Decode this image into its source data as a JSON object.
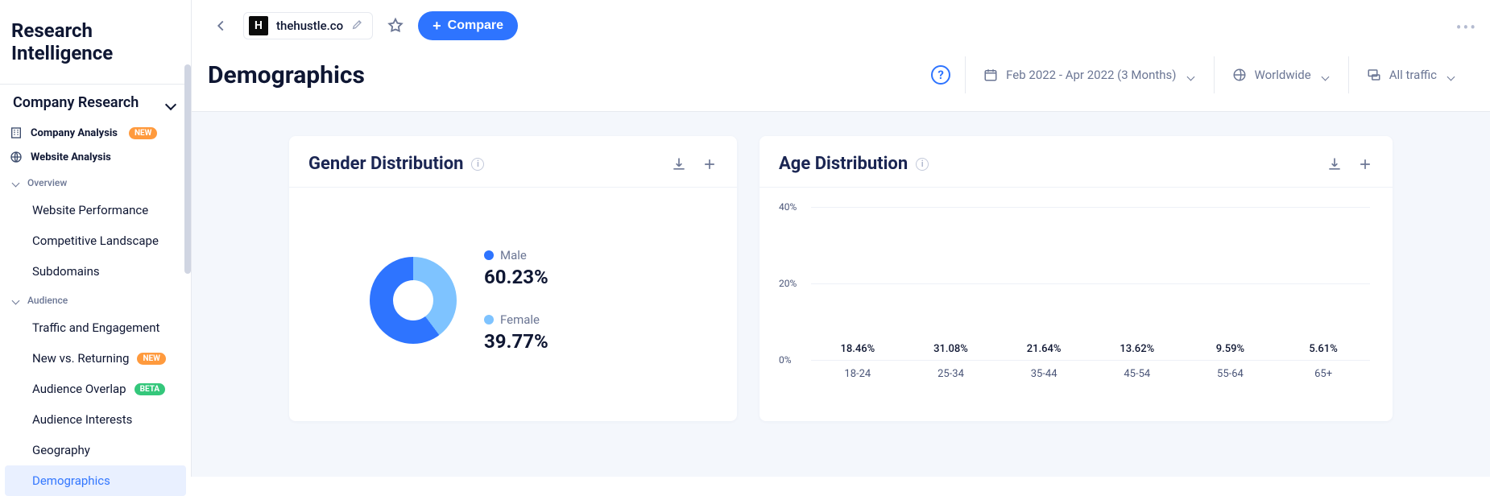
{
  "brand": "Research Intelligence",
  "sidebar": {
    "section": "Company Research",
    "items_top": [
      {
        "label": "Company Analysis",
        "badge": "NEW",
        "badge_kind": "new"
      },
      {
        "label": "Website Analysis",
        "badge": "",
        "badge_kind": ""
      }
    ],
    "groups": [
      {
        "label": "Overview",
        "items": [
          {
            "label": "Website Performance",
            "badge": "",
            "badge_kind": ""
          },
          {
            "label": "Competitive Landscape",
            "badge": "",
            "badge_kind": ""
          },
          {
            "label": "Subdomains",
            "badge": "",
            "badge_kind": ""
          }
        ]
      },
      {
        "label": "Audience",
        "items": [
          {
            "label": "Traffic and Engagement",
            "badge": "",
            "badge_kind": ""
          },
          {
            "label": "New vs. Returning",
            "badge": "NEW",
            "badge_kind": "new"
          },
          {
            "label": "Audience Overlap",
            "badge": "BETA",
            "badge_kind": "beta"
          },
          {
            "label": "Audience Interests",
            "badge": "",
            "badge_kind": ""
          },
          {
            "label": "Geography",
            "badge": "",
            "badge_kind": ""
          },
          {
            "label": "Demographics",
            "badge": "",
            "badge_kind": "",
            "active": true
          }
        ]
      }
    ]
  },
  "topbar": {
    "site": "thehustle.co",
    "site_initial": "H",
    "compare_label": "Compare",
    "help": "?"
  },
  "page_title": "Demographics",
  "filters": {
    "date": "Feb 2022 - Apr 2022 (3 Months)",
    "region": "Worldwide",
    "traffic": "All traffic"
  },
  "colors": {
    "primary": "#2e74ff",
    "bar": "#3b82f6",
    "male": "#2e74ff",
    "female": "#7ec3ff"
  },
  "cards": {
    "gender": {
      "title": "Gender Distribution",
      "series": [
        {
          "label": "Male",
          "value_text": "60.23%",
          "value": 60.23,
          "color": "#2e74ff"
        },
        {
          "label": "Female",
          "value_text": "39.77%",
          "value": 39.77,
          "color": "#7ec3ff"
        }
      ]
    },
    "age": {
      "title": "Age Distribution"
    }
  },
  "chart_data": [
    {
      "type": "pie",
      "title": "Gender Distribution",
      "categories": [
        "Male",
        "Female"
      ],
      "values": [
        60.23,
        39.77
      ]
    },
    {
      "type": "bar",
      "title": "Age Distribution",
      "xlabel": "",
      "ylabel": "",
      "ylim": [
        0,
        40
      ],
      "yticks": [
        0,
        20,
        40
      ],
      "ytick_labels": [
        "0%",
        "20%",
        "40%"
      ],
      "categories": [
        "18-24",
        "25-34",
        "35-44",
        "45-54",
        "55-64",
        "65+"
      ],
      "values": [
        18.46,
        31.08,
        21.64,
        13.62,
        9.59,
        5.61
      ],
      "value_labels": [
        "18.46%",
        "31.08%",
        "21.64%",
        "13.62%",
        "9.59%",
        "5.61%"
      ]
    }
  ]
}
